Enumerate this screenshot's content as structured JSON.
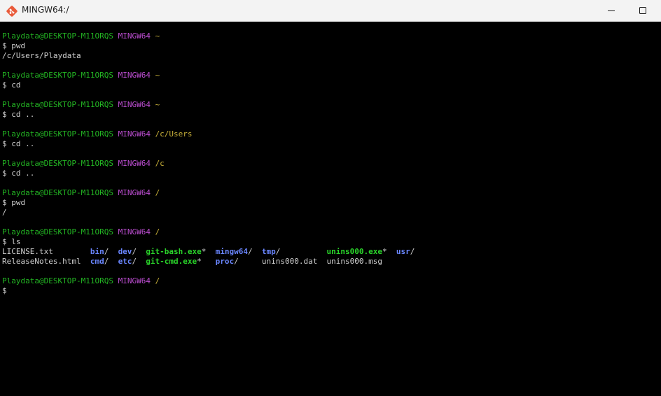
{
  "window": {
    "title": "MINGW64:/",
    "colors": {
      "background": "#000000",
      "titlebar": "#f3f3f3",
      "prompt_user": "#23b623",
      "prompt_shell": "#bd4ed2",
      "prompt_path": "#c9b13a",
      "directory": "#6a86ff",
      "executable": "#2ad42a",
      "text": "#cfcfcf"
    },
    "icons": {
      "app": "git-logo-icon",
      "minimize": "minimize-icon",
      "maximize": "maximize-icon"
    }
  },
  "terminal": {
    "blocks": [
      {
        "prompt": {
          "user_host": "Playdata@DESKTOP-M11ORQS",
          "shell": "MINGW64",
          "path": "~"
        },
        "command": "$ pwd",
        "output": [
          "/c/Users/Playdata"
        ]
      },
      {
        "prompt": {
          "user_host": "Playdata@DESKTOP-M11ORQS",
          "shell": "MINGW64",
          "path": "~"
        },
        "command": "$ cd",
        "output": []
      },
      {
        "prompt": {
          "user_host": "Playdata@DESKTOP-M11ORQS",
          "shell": "MINGW64",
          "path": "~"
        },
        "command": "$ cd ..",
        "output": []
      },
      {
        "prompt": {
          "user_host": "Playdata@DESKTOP-M11ORQS",
          "shell": "MINGW64",
          "path": "/c/Users"
        },
        "command": "$ cd ..",
        "output": []
      },
      {
        "prompt": {
          "user_host": "Playdata@DESKTOP-M11ORQS",
          "shell": "MINGW64",
          "path": "/c"
        },
        "command": "$ cd ..",
        "output": []
      },
      {
        "prompt": {
          "user_host": "Playdata@DESKTOP-M11ORQS",
          "shell": "MINGW64",
          "path": "/"
        },
        "command": "$ pwd",
        "output": [
          "/"
        ]
      },
      {
        "prompt": {
          "user_host": "Playdata@DESKTOP-M11ORQS",
          "shell": "MINGW64",
          "path": "/"
        },
        "command": "$ ls",
        "output": []
      }
    ],
    "ls_rows": [
      [
        {
          "name": "LICENSE.txt",
          "suffix": "",
          "type": "file"
        },
        {
          "name": "bin",
          "suffix": "/",
          "type": "dir"
        },
        {
          "name": "dev",
          "suffix": "/",
          "type": "dir"
        },
        {
          "name": "git-bash.exe",
          "suffix": "*",
          "type": "exe"
        },
        {
          "name": "mingw64",
          "suffix": "/",
          "type": "dir"
        },
        {
          "name": "tmp",
          "suffix": "/",
          "type": "dir"
        },
        {
          "name": "unins000.exe",
          "suffix": "*",
          "type": "exe"
        },
        {
          "name": "usr",
          "suffix": "/",
          "type": "dir"
        }
      ],
      [
        {
          "name": "ReleaseNotes.html",
          "suffix": "",
          "type": "file"
        },
        {
          "name": "cmd",
          "suffix": "/",
          "type": "dir"
        },
        {
          "name": "etc",
          "suffix": "/",
          "type": "dir"
        },
        {
          "name": "git-cmd.exe",
          "suffix": "*",
          "type": "exe"
        },
        {
          "name": "proc",
          "suffix": "/",
          "type": "dir"
        },
        {
          "name": "unins000.dat",
          "suffix": "",
          "type": "file"
        },
        {
          "name": "unins000.msg",
          "suffix": "",
          "type": "file"
        }
      ]
    ],
    "final_prompt": {
      "user_host": "Playdata@DESKTOP-M11ORQS",
      "shell": "MINGW64",
      "path": "/"
    },
    "input_prompt": "$"
  }
}
